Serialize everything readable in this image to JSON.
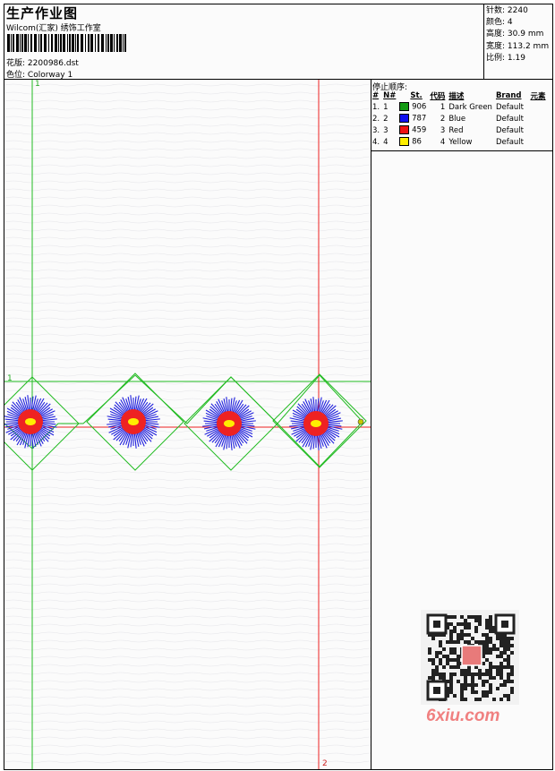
{
  "header": {
    "title": "生产作业图",
    "studio": "Wilcom(汇家) 绣饰工作室",
    "design_label": "花版:",
    "design_file": "2200986.dst",
    "colorway_label": "色位:",
    "colorway": "Colorway 1"
  },
  "stats": [
    {
      "label": "针数:",
      "value": "2240"
    },
    {
      "label": "颜色:",
      "value": "4"
    },
    {
      "label": "高度:",
      "value": "30.9 mm"
    },
    {
      "label": "宽度:",
      "value": "113.2 mm"
    },
    {
      "label": "比例:",
      "value": "1.19"
    }
  ],
  "stop_sequence": {
    "title": "停止顺序:",
    "headers": [
      "#",
      "N#",
      "St.",
      "代码",
      "描述",
      "Brand",
      "元素"
    ],
    "rows": [
      {
        "idx": "1.",
        "n": "1",
        "color": "#119911",
        "st": "906",
        "code": "1",
        "desc": "Dark Green",
        "brand": "Default"
      },
      {
        "idx": "2.",
        "n": "2",
        "color": "#1010ee",
        "st": "787",
        "code": "2",
        "desc": "Blue",
        "brand": "Default"
      },
      {
        "idx": "3.",
        "n": "3",
        "color": "#ee1111",
        "st": "459",
        "code": "3",
        "desc": "Red",
        "brand": "Default"
      },
      {
        "idx": "4.",
        "n": "4",
        "color": "#ffee00",
        "st": "86",
        "code": "4",
        "desc": "Yellow",
        "brand": "Default"
      }
    ]
  },
  "canvas": {
    "guide_v_label": "1",
    "guide_h_label": "1",
    "guide_red_label": "2",
    "green_color": "#22bb22",
    "red_color": "#ee2222",
    "blue_color": "#2020dd",
    "yellow_color": "#ffee00"
  },
  "watermark": {
    "logo": "6xiu.com"
  }
}
